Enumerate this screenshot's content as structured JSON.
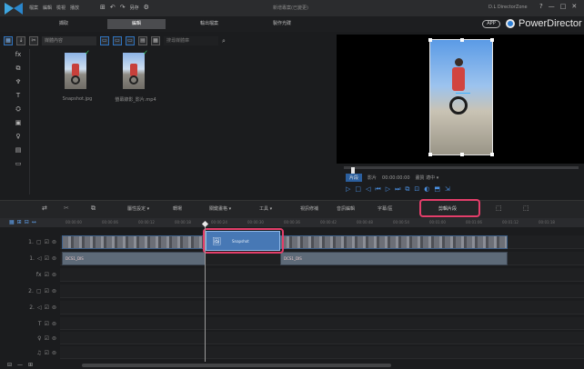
{
  "titlebar": {
    "menu": [
      "檔案",
      "編輯",
      "檢視",
      "播放"
    ],
    "tools": [
      "⊞",
      "↶",
      "↷",
      "另存",
      "⚙"
    ],
    "project_name": "新增專案(已變更)",
    "director_zone": "D.L DirectorZone",
    "window_controls": [
      "?",
      "—",
      "□",
      "✕"
    ]
  },
  "modes": {
    "tabs": [
      "擷取",
      "編輯",
      "輸出檔案",
      "製作光碟"
    ],
    "active_index": 1,
    "app_badge": "APP",
    "product_name": "PowerDirector"
  },
  "library": {
    "toolbar_icons": [
      "▦",
      "↓",
      "✂"
    ],
    "filter_label": "媒體內容",
    "view_icons": [
      "▭",
      "▭",
      "▭",
      "▤",
      "▦"
    ],
    "search_placeholder": "搜尋媒體庫",
    "side_tools": [
      "fx",
      "⧉",
      "♆",
      "T",
      "⛭",
      "▣",
      "♀",
      "▤",
      "▭"
    ],
    "items": [
      {
        "label": "Snapshot.jpg",
        "checked": true
      },
      {
        "label": "螢幕錄影_影片.mp4",
        "checked": true
      }
    ]
  },
  "preview": {
    "mode_label": "片段",
    "status_text": [
      "影片",
      "00:00:00:00",
      "畫質 適中 ▾"
    ],
    "controls": [
      "▷",
      "□",
      "◁",
      "⏮",
      "▷",
      "⏭",
      "⧉",
      "⊡",
      "◐",
      "⬒",
      "⇲"
    ]
  },
  "timeline_toolbar": {
    "items": [
      "⇄",
      "✂",
      "⧉",
      "屬性設定 ▾",
      "轉場",
      "關鍵畫格 ▾",
      "工具 ▾",
      "視訊修補",
      "音訊編輯",
      "字幕/區",
      "剪輯片段",
      "⬚",
      "⬚"
    ],
    "highlighted": "剪輯片段"
  },
  "ruler": {
    "icons": [
      "▦",
      "⊞",
      "⊟",
      "↔"
    ],
    "ticks": [
      "00:00:00",
      "00:00:06",
      "00:00:12",
      "00:00:18",
      "00:00:24",
      "00:00:30",
      "00:00:36",
      "00:00:42",
      "00:00:48",
      "00:00:54",
      "00:01:00",
      "00:01:06",
      "00:01:12",
      "00:01:18"
    ]
  },
  "tracks": [
    {
      "label": "1.",
      "icons": [
        "▢",
        "☑",
        "⊜"
      ]
    },
    {
      "label": "1.",
      "icons": [
        "◁",
        "☑",
        "⊜"
      ]
    },
    {
      "label": "",
      "icons": [
        "fx",
        "☑",
        "⊜"
      ]
    },
    {
      "label": "2.",
      "icons": [
        "▢",
        "☑",
        "⊜"
      ]
    },
    {
      "label": "2.",
      "icons": [
        "◁",
        "☑",
        "⊜"
      ]
    },
    {
      "label": "",
      "icons": [
        "T",
        "☑",
        "⊜"
      ]
    },
    {
      "label": "",
      "icons": [
        "♀",
        "☑",
        "⊜"
      ]
    },
    {
      "label": "",
      "icons": [
        "♫",
        "☑",
        "⊜"
      ]
    }
  ],
  "clips": {
    "video_label": "DCS1_DIS",
    "audio_label": "DCS1_DIS",
    "title_label": "Snapshot"
  },
  "bottombar": {
    "zoom_icons": [
      "⊟",
      "—",
      "⊞"
    ]
  },
  "colors": {
    "accent_blue": "#2f74c0",
    "highlight_pink": "#e33e6a",
    "title_clip": "#4778b5"
  }
}
